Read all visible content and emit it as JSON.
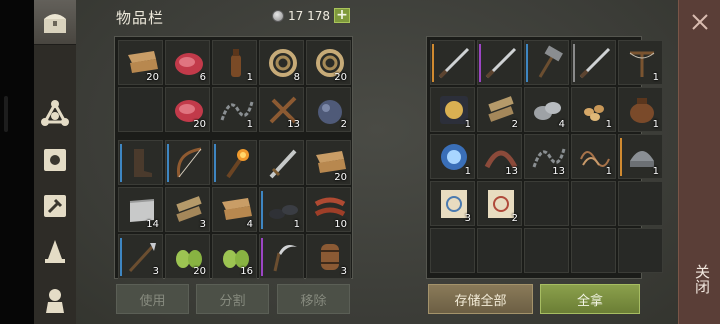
{
  "inventory": {
    "title": "物品栏",
    "currency_value": "17 178",
    "plus_label": "+"
  },
  "rarity_colors": {
    "common": "#3a3b36",
    "blue": "#3e86c2",
    "purple": "#9c45c4",
    "orange": "#d08a30",
    "grey": "#8a8a8a"
  },
  "left_slots": [
    {
      "icon": "leather-icon",
      "count": "20"
    },
    {
      "icon": "meat-icon",
      "count": "6"
    },
    {
      "icon": "bottle-icon",
      "count": "1"
    },
    {
      "icon": "rope-icon",
      "count": "8"
    },
    {
      "icon": "rope-icon",
      "count": "20"
    },
    {
      "icon": "",
      "count": ""
    },
    {
      "icon": "meat-icon",
      "count": "20"
    },
    {
      "icon": "chain-icon",
      "count": "1"
    },
    {
      "icon": "sticks-icon",
      "count": "13"
    },
    {
      "icon": "ore-bag-icon",
      "count": "2"
    },
    {
      "icon": "boots-icon",
      "count": "",
      "rarity": "blue"
    },
    {
      "icon": "bow-icon",
      "count": "",
      "rarity": "blue"
    },
    {
      "icon": "torch-icon",
      "count": "",
      "rarity": "blue"
    },
    {
      "icon": "sword-icon",
      "count": ""
    },
    {
      "icon": "leather-icon",
      "count": "20"
    },
    {
      "icon": "cloth-icon",
      "count": "14"
    },
    {
      "icon": "planks-icon",
      "count": "3"
    },
    {
      "icon": "leather-icon",
      "count": "4"
    },
    {
      "icon": "shoes-icon",
      "count": "1",
      "rarity": "blue"
    },
    {
      "icon": "meat-strips-icon",
      "count": "10"
    },
    {
      "icon": "spear-icon",
      "count": "3",
      "rarity": "blue"
    },
    {
      "icon": "fiber-icon",
      "count": "20"
    },
    {
      "icon": "fiber-icon",
      "count": "16"
    },
    {
      "icon": "sickle-icon",
      "count": "",
      "rarity": "purple"
    },
    {
      "icon": "barrel-icon",
      "count": "3"
    }
  ],
  "right_slots": [
    {
      "icon": "blade-icon",
      "count": "",
      "rarity": "orange"
    },
    {
      "icon": "blade-icon",
      "count": "",
      "rarity": "purple"
    },
    {
      "icon": "hammer-icon",
      "count": "",
      "rarity": "blue"
    },
    {
      "icon": "blade-icon",
      "count": "",
      "rarity": "grey"
    },
    {
      "icon": "crossbow-icon",
      "count": "1"
    },
    {
      "icon": "mask-icon",
      "count": "1"
    },
    {
      "icon": "planks-icon",
      "count": "2"
    },
    {
      "icon": "stones-icon",
      "count": "4"
    },
    {
      "icon": "seeds-icon",
      "count": "1"
    },
    {
      "icon": "pot-icon",
      "count": "1"
    },
    {
      "icon": "orb-icon",
      "count": "1"
    },
    {
      "icon": "leather-strips-icon",
      "count": "13"
    },
    {
      "icon": "chain-icon",
      "count": "13"
    },
    {
      "icon": "wire-icon",
      "count": "1"
    },
    {
      "icon": "helmet-icon",
      "count": "1",
      "rarity": "orange"
    },
    {
      "icon": "scroll-blue-icon",
      "count": "3"
    },
    {
      "icon": "scroll-red-icon",
      "count": "2"
    },
    {
      "icon": "",
      "count": ""
    },
    {
      "icon": "",
      "count": ""
    },
    {
      "icon": "",
      "count": ""
    },
    {
      "icon": "",
      "count": ""
    },
    {
      "icon": "",
      "count": ""
    },
    {
      "icon": "",
      "count": ""
    },
    {
      "icon": "",
      "count": ""
    },
    {
      "icon": "",
      "count": ""
    }
  ],
  "left_buttons": {
    "use": "使用",
    "split": "分割",
    "remove": "移除"
  },
  "right_buttons": {
    "store_all": "存储全部",
    "take_all": "全拿"
  },
  "close": {
    "label": "关闭"
  }
}
